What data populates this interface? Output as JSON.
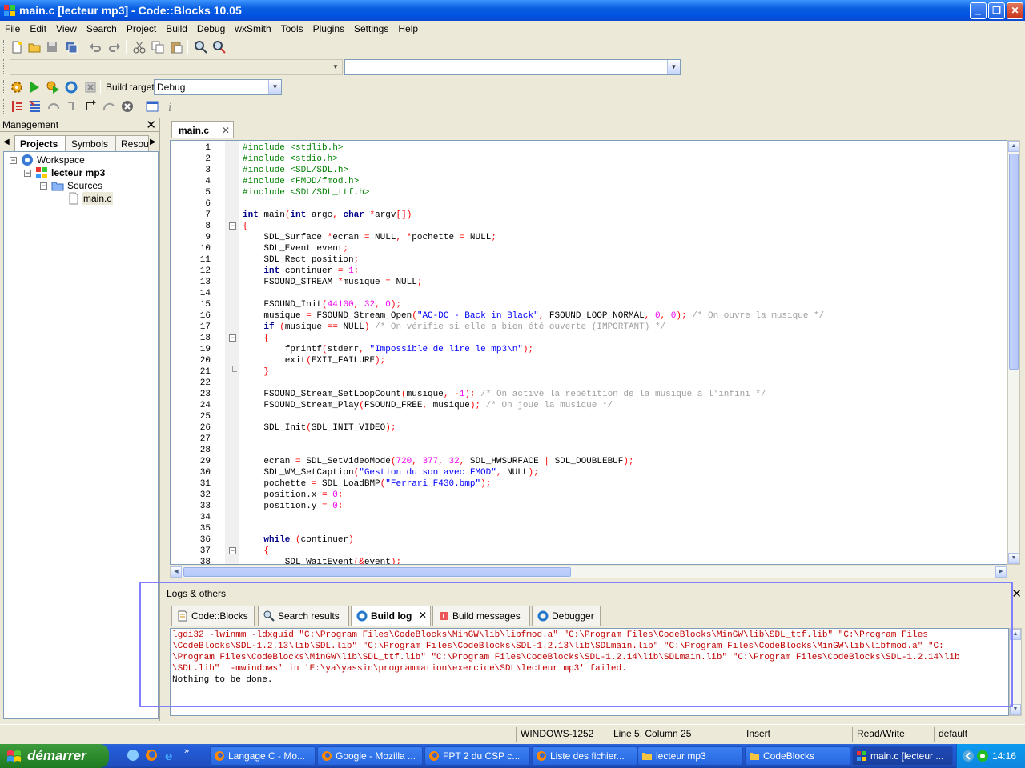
{
  "window": {
    "title": "main.c [lecteur mp3] - Code::Blocks 10.05"
  },
  "menu": [
    "File",
    "Edit",
    "View",
    "Search",
    "Project",
    "Build",
    "Debug",
    "wxSmith",
    "Tools",
    "Plugins",
    "Settings",
    "Help"
  ],
  "build_target": {
    "label": "Build target:",
    "value": "Debug"
  },
  "management": {
    "title": "Management",
    "tabs": [
      "Projects",
      "Symbols",
      "Resou"
    ],
    "tree": {
      "workspace": "Workspace",
      "project": "lecteur mp3",
      "folder": "Sources",
      "file": "main.c"
    }
  },
  "editor": {
    "tab": "main.c",
    "lines": [
      "#include <stdlib.h>",
      "#include <stdio.h>",
      "#include <SDL/SDL.h>",
      "#include <FMOD/fmod.h>",
      "#include <SDL/SDL_ttf.h>",
      "",
      "int main(int argc, char *argv[])",
      "{",
      "    SDL_Surface *ecran = NULL, *pochette = NULL;",
      "    SDL_Event event;",
      "    SDL_Rect position;",
      "    int continuer = 1;",
      "    FSOUND_STREAM *musique = NULL;",
      "",
      "    FSOUND_Init(44100, 32, 0);",
      "    musique = FSOUND_Stream_Open(\"AC-DC - Back in Black\", FSOUND_LOOP_NORMAL, 0, 0); /* On ouvre la musique */",
      "    if (musique == NULL) /* On vérifie si elle a bien été ouverte (IMPORTANT) */",
      "    {",
      "        fprintf(stderr, \"Impossible de lire le mp3\\n\");",
      "        exit(EXIT_FAILURE);",
      "    }",
      "",
      "    FSOUND_Stream_SetLoopCount(musique, -1); /* On active la répétition de la musique à l'infini */",
      "    FSOUND_Stream_Play(FSOUND_FREE, musique); /* On joue la musique */",
      "",
      "    SDL_Init(SDL_INIT_VIDEO);",
      "",
      "",
      "    ecran = SDL_SetVideoMode(720, 377, 32, SDL_HWSURFACE | SDL_DOUBLEBUF);",
      "    SDL_WM_SetCaption(\"Gestion du son avec FMOD\", NULL);",
      "    pochette = SDL_LoadBMP(\"Ferrari_F430.bmp\");",
      "    position.x = 0;",
      "    position.y = 0;",
      "",
      "",
      "    while (continuer)",
      "    {",
      "        SDL_WaitEvent(&event);"
    ]
  },
  "logs": {
    "title": "Logs & others",
    "tabs": [
      "Code::Blocks",
      "Search results",
      "Build log",
      "Build messages",
      "Debugger"
    ],
    "lines": [
      "lgdi32 -lwinmm -ldxguid \"C:\\Program Files\\CodeBlocks\\MinGW\\lib\\libfmod.a\" \"C:\\Program Files\\CodeBlocks\\MinGW\\lib\\SDL_ttf.lib\" \"C:\\Program Files",
      "\\CodeBlocks\\SDL-1.2.13\\lib\\SDL.lib\" \"C:\\Program Files\\CodeBlocks\\SDL-1.2.13\\lib\\SDLmain.lib\" \"C:\\Program Files\\CodeBlocks\\MinGW\\lib\\libfmod.a\" \"C:",
      "\\Program Files\\CodeBlocks\\MinGW\\lib\\SDL_ttf.lib\" \"C:\\Program Files\\CodeBlocks\\SDL-1.2.14\\lib\\SDLmain.lib\" \"C:\\Program Files\\CodeBlocks\\SDL-1.2.14\\lib",
      "\\SDL.lib\"  -mwindows' in 'E:\\ya\\yassin\\programmation\\exercice\\SDL\\lecteur mp3' failed.",
      "Nothing to be done."
    ]
  },
  "status": {
    "encoding": "WINDOWS-1252",
    "position": "Line 5, Column 25",
    "mode": "Insert",
    "access": "Read/Write",
    "profile": "default"
  },
  "taskbar": {
    "start": "démarrer",
    "tasks": [
      "Langage C - Mo...",
      "Google - Mozilla ...",
      "FPT 2 du CSP c...",
      "Liste des fichier...",
      "lecteur mp3",
      "CodeBlocks",
      "main.c [lecteur ..."
    ],
    "time": "14:16"
  }
}
